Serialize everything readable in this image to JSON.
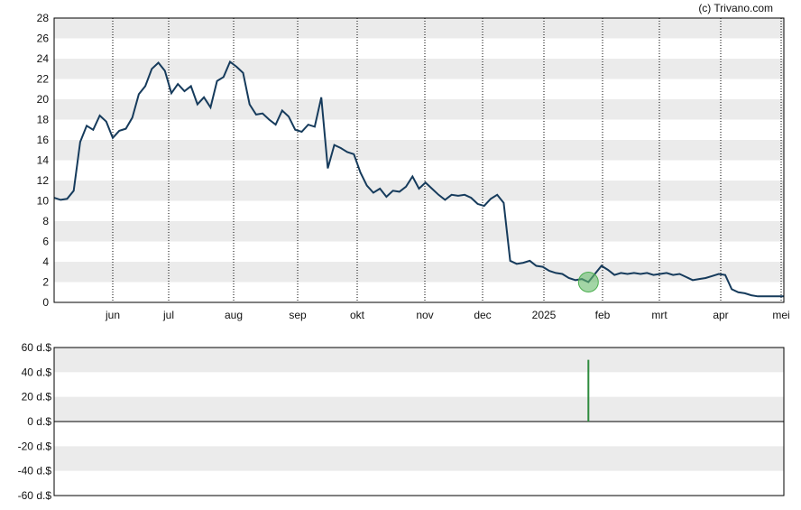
{
  "credit": "(c) Trivano.com",
  "colors": {
    "line": "#163b5c",
    "band": "#ebebeb",
    "marker_fill": "#66bb6a",
    "marker_stroke": "#4caf50",
    "volume": "#2e8b3e",
    "grid": "#000000"
  },
  "chart_data": [
    {
      "type": "line",
      "title": "",
      "xlabel": "",
      "ylabel": "",
      "ylim": [
        0,
        28
      ],
      "grid": true,
      "y_ticks": [
        "0",
        "2",
        "4",
        "6",
        "8",
        "10",
        "12",
        "14",
        "16",
        "18",
        "20",
        "22",
        "24",
        "26",
        "28"
      ],
      "x_ticks": [
        "jun",
        "jul",
        "aug",
        "sep",
        "okt",
        "nov",
        "dec",
        "2025",
        "feb",
        "mrt",
        "apr",
        "mei"
      ],
      "series": [
        {
          "values": [
            10.3,
            10.1,
            10.2,
            11.0,
            15.8,
            17.4,
            17.0,
            18.4,
            17.8,
            16.2,
            16.9,
            17.1,
            18.2,
            20.5,
            21.3,
            23.0,
            23.6,
            22.8,
            20.6,
            21.5,
            20.8,
            21.3,
            19.5,
            20.2,
            19.2,
            21.8,
            22.2,
            23.7,
            23.2,
            22.6,
            19.5,
            18.5,
            18.6,
            18.0,
            17.5,
            18.9,
            18.3,
            17.0,
            16.8,
            17.5,
            17.3,
            20.2,
            13.2,
            15.5,
            15.2,
            14.8,
            14.6,
            12.8,
            11.5,
            10.8,
            11.2,
            10.4,
            11.0,
            10.9,
            11.4,
            12.4,
            11.2,
            11.8,
            11.2,
            10.6,
            10.1,
            10.6,
            10.5,
            10.6,
            10.3,
            9.7,
            9.5,
            10.2,
            10.6,
            9.8,
            4.1,
            3.8,
            3.9,
            4.1,
            3.6,
            3.5,
            3.1,
            2.9,
            2.8,
            2.4,
            2.2,
            2.3,
            2.0,
            2.8,
            3.6,
            3.2,
            2.7,
            2.9,
            2.8,
            2.9,
            2.8,
            2.9,
            2.7,
            2.8,
            2.9,
            2.7,
            2.8,
            2.5,
            2.2,
            2.3,
            2.4,
            2.6,
            2.8,
            2.7,
            1.3,
            1.0,
            0.9,
            0.7,
            0.6,
            0.6,
            0.6,
            0.6,
            0.6
          ]
        }
      ],
      "annotations": [
        {
          "type": "marker",
          "x_index": 82,
          "y": 2.0
        }
      ]
    },
    {
      "type": "bar",
      "title": "",
      "xlabel": "",
      "ylabel": "",
      "ylim": [
        -60,
        60
      ],
      "grid": true,
      "y_ticks": [
        "60 d.$",
        "40 d.$",
        "20 d.$",
        "0 d.$",
        "-20 d.$",
        "-40 d.$",
        "-60 d.$"
      ],
      "series": [
        {
          "values": [
            50
          ],
          "x_index": 82
        }
      ]
    }
  ]
}
